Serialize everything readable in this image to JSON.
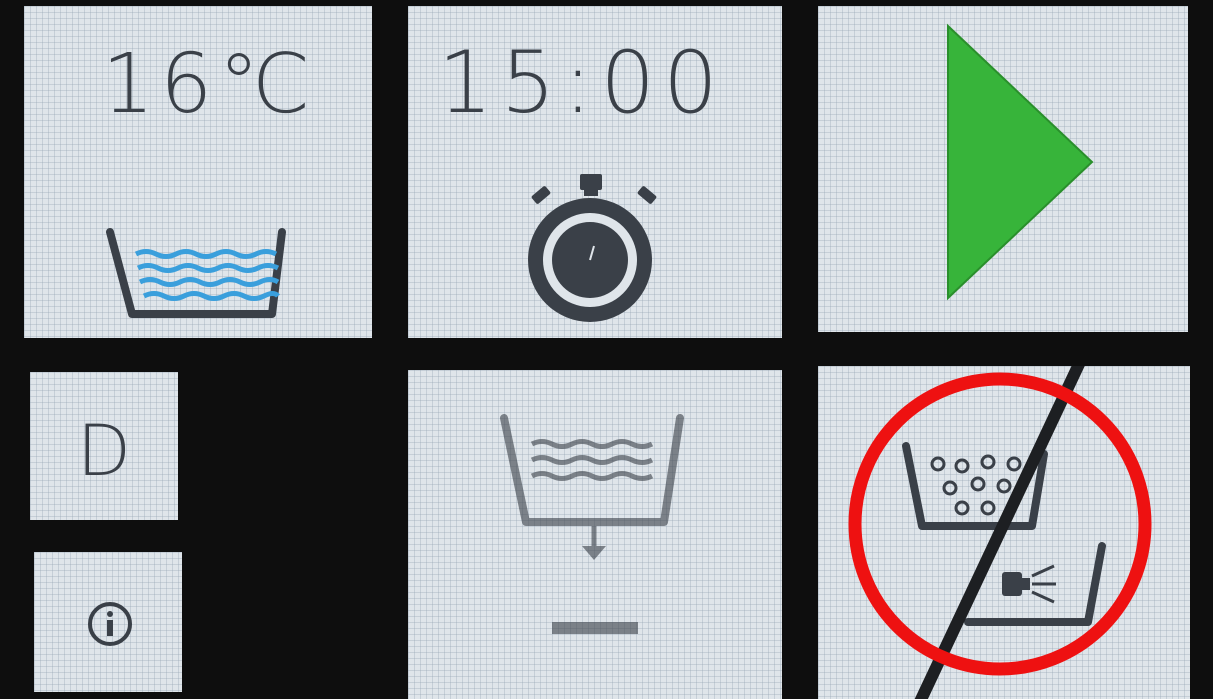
{
  "panel": {
    "temperature": {
      "value": "16℃",
      "icon": "water-basin-icon"
    },
    "timer": {
      "value": "15:00",
      "icon": "stopwatch-icon"
    },
    "start": {
      "icon": "play-icon",
      "color": "#37b43a"
    },
    "mode": {
      "label": "D"
    },
    "info": {
      "icon": "info-icon"
    },
    "drain": {
      "icon": "drain-basin-icon"
    },
    "no_fill": {
      "icon": "bubbles-basin-crossed-icon"
    }
  },
  "annotation": {
    "color": "#ee1111",
    "shape": "circle"
  },
  "colors": {
    "background": "#0e0e0e",
    "tile": "#dfe5ea",
    "icon": "#3a4048",
    "water": "#3a9fdc"
  }
}
